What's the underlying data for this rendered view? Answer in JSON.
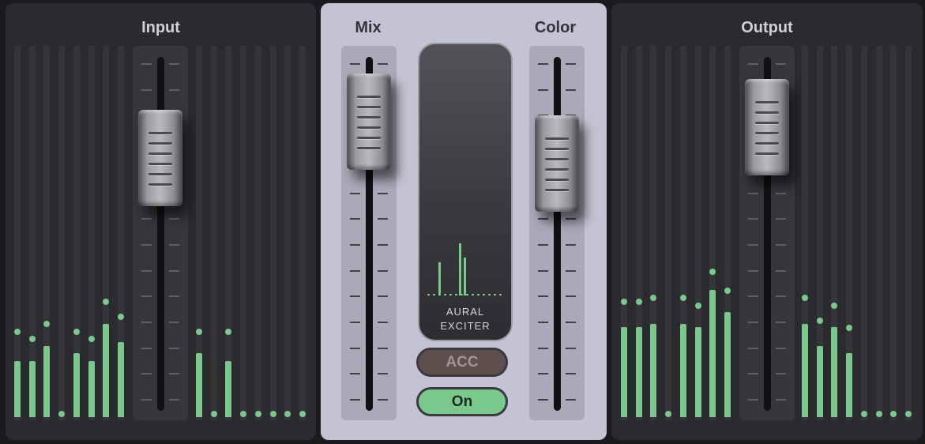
{
  "colors": {
    "meter": "#7ac98c",
    "panel_dark": "#2b2b2f",
    "panel_light": "#c3c3d3"
  },
  "input": {
    "title": "Input",
    "fader_level": 0.77,
    "meters_left": [
      {
        "level": 0.15,
        "peak": 0.22
      },
      {
        "level": 0.15,
        "peak": 0.2
      },
      {
        "level": 0.19,
        "peak": 0.24
      },
      {
        "level": 0.0,
        "peak": 0.0
      },
      {
        "level": 0.17,
        "peak": 0.22
      },
      {
        "level": 0.15,
        "peak": 0.2
      },
      {
        "level": 0.25,
        "peak": 0.3
      },
      {
        "level": 0.2,
        "peak": 0.26
      }
    ],
    "meters_right": [
      {
        "level": 0.17,
        "peak": 0.22
      },
      {
        "level": 0.0,
        "peak": 0.0
      },
      {
        "level": 0.15,
        "peak": 0.22
      },
      {
        "level": 0.0,
        "peak": 0.0
      },
      {
        "level": 0.0,
        "peak": 0.0
      },
      {
        "level": 0.0,
        "peak": 0.0
      },
      {
        "level": 0.0,
        "peak": 0.0
      },
      {
        "level": 0.0,
        "peak": 0.0
      }
    ]
  },
  "center": {
    "mix": {
      "label": "Mix",
      "level": 0.9
    },
    "color": {
      "label": "Color",
      "level": 0.75
    },
    "display": {
      "line1": "AURAL",
      "line2": "EXCITER",
      "spikes": [
        0.35,
        0.55,
        0.4
      ]
    },
    "acc_button": "ACC",
    "on_button": "On"
  },
  "output": {
    "title": "Output",
    "fader_level": 0.88,
    "meters_left": [
      {
        "level": 0.24,
        "peak": 0.3
      },
      {
        "level": 0.24,
        "peak": 0.3
      },
      {
        "level": 0.25,
        "peak": 0.31
      },
      {
        "level": 0.0,
        "peak": 0.0
      },
      {
        "level": 0.25,
        "peak": 0.31
      },
      {
        "level": 0.24,
        "peak": 0.29
      },
      {
        "level": 0.34,
        "peak": 0.38
      },
      {
        "level": 0.28,
        "peak": 0.33
      }
    ],
    "meters_right": [
      {
        "level": 0.25,
        "peak": 0.31
      },
      {
        "level": 0.19,
        "peak": 0.25
      },
      {
        "level": 0.24,
        "peak": 0.29
      },
      {
        "level": 0.17,
        "peak": 0.23
      },
      {
        "level": 0.0,
        "peak": 0.0
      },
      {
        "level": 0.0,
        "peak": 0.0
      },
      {
        "level": 0.0,
        "peak": 0.0
      },
      {
        "level": 0.0,
        "peak": 0.0
      }
    ]
  }
}
